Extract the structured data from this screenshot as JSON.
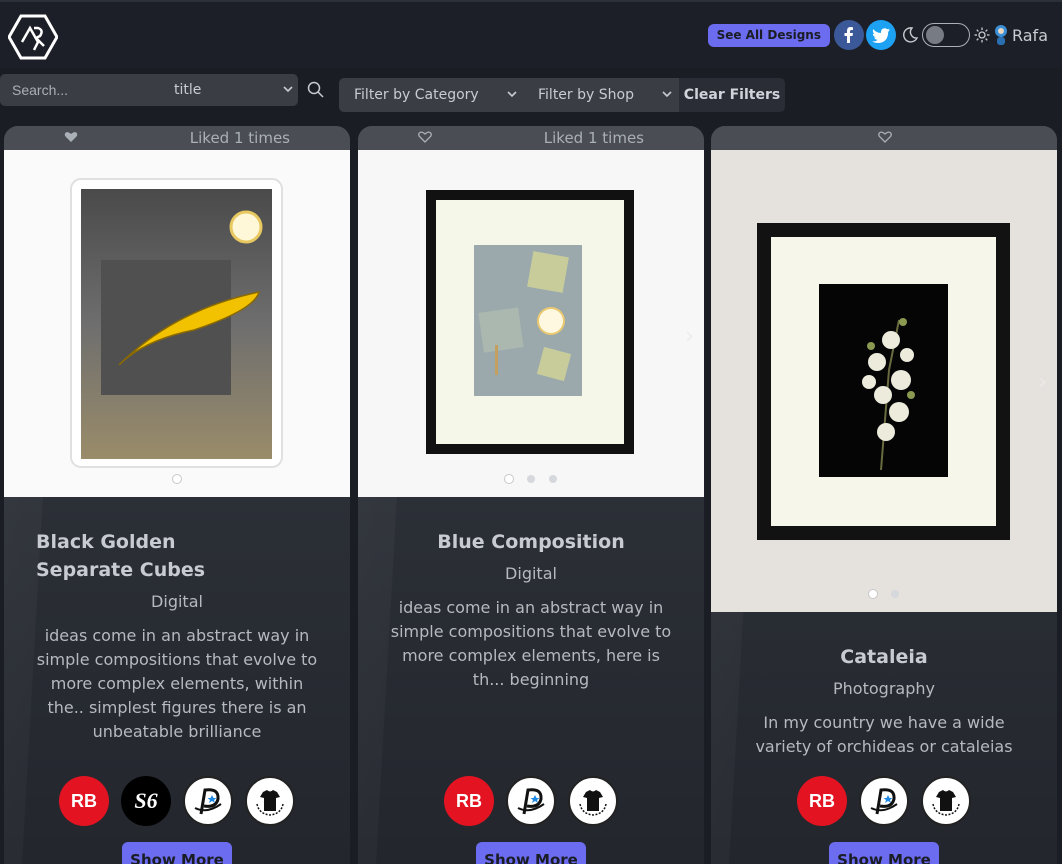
{
  "header": {
    "see_all_label": "See All Designs",
    "user_name": "Rafa"
  },
  "filters": {
    "search_placeholder": "Search...",
    "search_field": "title",
    "category_label": "Filter by Category",
    "shop_label": "Filter by Shop",
    "clear_label": "Clear Filters"
  },
  "cards": [
    {
      "liked_text": "Liked 1 times",
      "title": "Black Golden Separate Cubes",
      "category": "Digital",
      "description": "ideas come in an abstract way in simple compositions that evolve to more complex elements, within the.. simplest figures there is an unbeatable brilliance",
      "shops": [
        "redbubble-icon",
        "society6-icon",
        "pixels-icon",
        "teepublic-icon"
      ],
      "button_label": "Show More"
    },
    {
      "liked_text": "Liked 1 times",
      "title": "Blue Composition",
      "category": "Digital",
      "description": "ideas come in an abstract way in simple compositions that evolve to more complex elements, here is th... beginning",
      "shops": [
        "redbubble-icon",
        "pixels-icon",
        "teepublic-icon"
      ],
      "button_label": "Show More"
    },
    {
      "liked_text": "",
      "title": "Cataleia",
      "category": "Photography",
      "description": "In my country we have a wide variety of orchideas or cataleias",
      "shops": [
        "redbubble-icon",
        "pixels-icon",
        "teepublic-icon"
      ],
      "button_label": "Show More"
    }
  ],
  "colors": {
    "accent": "#6c6cf0",
    "background": "#1a1d24",
    "redbubble": "#e41321",
    "facebook": "#3b5998",
    "twitter": "#1da1f2"
  }
}
